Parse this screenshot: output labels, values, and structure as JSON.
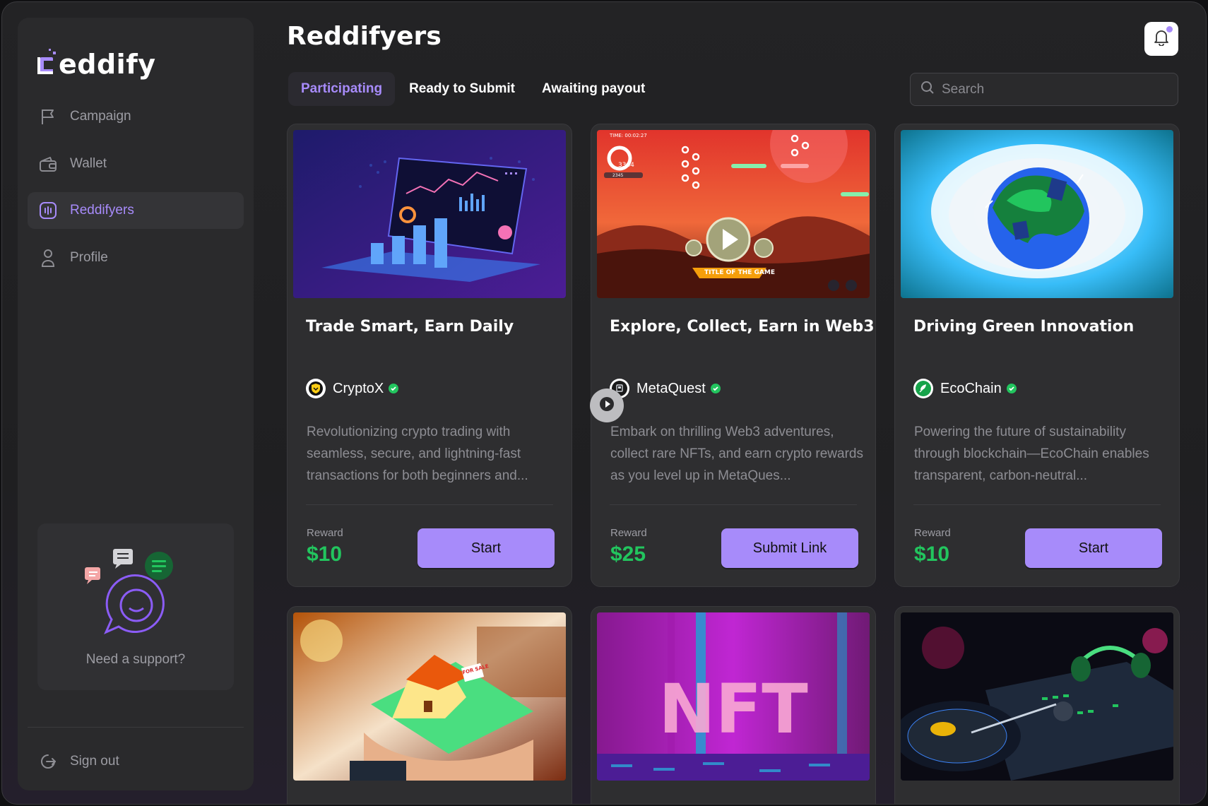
{
  "app": {
    "logo_text": "eddify"
  },
  "sidebar": {
    "items": [
      {
        "label": "Campaign",
        "icon": "flag-icon"
      },
      {
        "label": "Wallet",
        "icon": "wallet-icon"
      },
      {
        "label": "Reddifyers",
        "icon": "audio-wave-icon",
        "active": true
      },
      {
        "label": "Profile",
        "icon": "user-icon"
      }
    ],
    "support_label": "Need a support?",
    "signout_label": "Sign out"
  },
  "header": {
    "title": "Reddifyers",
    "tabs": [
      {
        "label": "Participating",
        "active": true
      },
      {
        "label": "Ready to Submit"
      },
      {
        "label": "Awaiting payout"
      }
    ],
    "search_placeholder": "Search"
  },
  "cards": [
    {
      "title": "Trade Smart, Earn Daily",
      "brand": "CryptoX",
      "description": "Revolutionizing crypto trading with seamless, secure, and lightning-fast transactions for both beginners and...",
      "reward_label": "Reward",
      "reward": "$10",
      "button": "Start"
    },
    {
      "title": "Explore, Collect, Earn in Web3",
      "brand": "MetaQuest",
      "description": "Embark on thrilling Web3 adventures, collect rare NFTs, and earn crypto rewards as you level up in MetaQues...",
      "reward_label": "Reward",
      "reward": "$25",
      "button": "Submit Link",
      "thumb_text": {
        "time": "TIME: 00:02:27",
        "score": "3364",
        "sub": "2345",
        "banner": "TITLE OF THE GAME"
      }
    },
    {
      "title": "Driving Green Innovation",
      "brand": "EcoChain",
      "description": "Powering the future of sustainability through blockchain—EcoChain enables transparent, carbon-neutral...",
      "reward_label": "Reward",
      "reward": "$10",
      "button": "Start"
    }
  ],
  "bottom_cards": [
    {
      "image": "house-on-phone",
      "sign_text": "FOR SALE"
    },
    {
      "image": "nft-neon",
      "overlay_text": "NFT"
    },
    {
      "image": "dj-turntable"
    }
  ],
  "colors": {
    "accent": "#a78bfa",
    "reward": "#22c55e",
    "verified": "#22c55e",
    "background": "#1f1f21",
    "panel": "#2a2a2c"
  }
}
